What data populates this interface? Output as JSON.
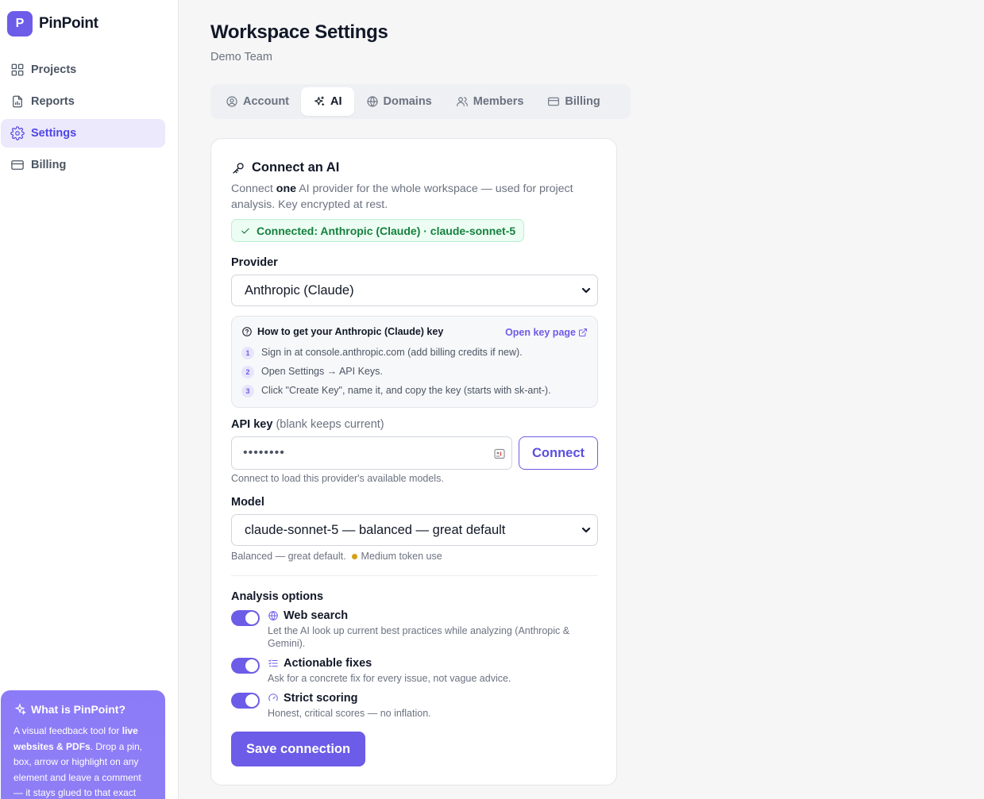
{
  "brand": {
    "logo_letter": "P",
    "name": "PinPoint"
  },
  "sidebar": {
    "items": [
      {
        "label": "Projects",
        "icon": "grid-icon",
        "active": false
      },
      {
        "label": "Reports",
        "icon": "report-icon",
        "active": false
      },
      {
        "label": "Settings",
        "icon": "gear-icon",
        "active": true
      },
      {
        "label": "Billing",
        "icon": "card-icon",
        "active": false
      }
    ],
    "promo": {
      "title": "What is PinPoint?",
      "text_1": "A visual feedback tool for ",
      "text_bold": "live websites & PDFs",
      "text_2": ". Drop a pin, box, arrow or highlight on any element and leave a comment — it stays glued to that exact"
    }
  },
  "page": {
    "title": "Workspace Settings",
    "subtitle": "Demo Team"
  },
  "tabs": [
    {
      "label": "Account",
      "icon": "user-circle-icon",
      "active": false
    },
    {
      "label": "AI",
      "icon": "sparkles-icon",
      "active": true
    },
    {
      "label": "Domains",
      "icon": "globe-icon",
      "active": false
    },
    {
      "label": "Members",
      "icon": "users-icon",
      "active": false
    },
    {
      "label": "Billing",
      "icon": "card-icon",
      "active": false
    }
  ],
  "ai_card": {
    "title": "Connect an AI",
    "desc_1": "Connect ",
    "desc_bold": "one",
    "desc_2": " AI provider for the whole workspace — used for project analysis. Key encrypted at rest.",
    "status": "Connected: Anthropic (Claude) · claude-sonnet-5",
    "provider_label": "Provider",
    "provider_value": "Anthropic (Claude)",
    "howto": {
      "title": "How to get your Anthropic (Claude) key",
      "link": "Open key page",
      "steps": [
        {
          "num": "1",
          "text": "Sign in at console.anthropic.com (add billing credits if new)."
        },
        {
          "num": "2",
          "text": "Open Settings → API Keys."
        },
        {
          "num": "3",
          "text": "Click \"Create Key\", name it, and copy the key (starts with sk-ant-)."
        }
      ]
    },
    "api_key_label": "API key",
    "api_key_label_muted": "(blank keeps current)",
    "api_key_value": "••••••••",
    "connect_button": "Connect",
    "api_key_hint": "Connect to load this provider's available models.",
    "model_label": "Model",
    "model_value": "claude-sonnet-5 — balanced — great default",
    "model_hint": "Balanced — great default.",
    "model_usage": "Medium token use",
    "analysis_label": "Analysis options",
    "options": [
      {
        "title": "Web search",
        "icon": "globe-icon",
        "desc": "Let the AI look up current best practices while analyzing (Anthropic & Gemini).",
        "enabled": true
      },
      {
        "title": "Actionable fixes",
        "icon": "checklist-icon",
        "desc": "Ask for a concrete fix for every issue, not vague advice.",
        "enabled": true
      },
      {
        "title": "Strict scoring",
        "icon": "gauge-icon",
        "desc": "Honest, critical scores — no inflation.",
        "enabled": true
      }
    ],
    "save_button": "Save connection"
  },
  "colors": {
    "accent": "#6c5ce7",
    "success": "#15803d",
    "usage_dot": "#d4a017"
  }
}
